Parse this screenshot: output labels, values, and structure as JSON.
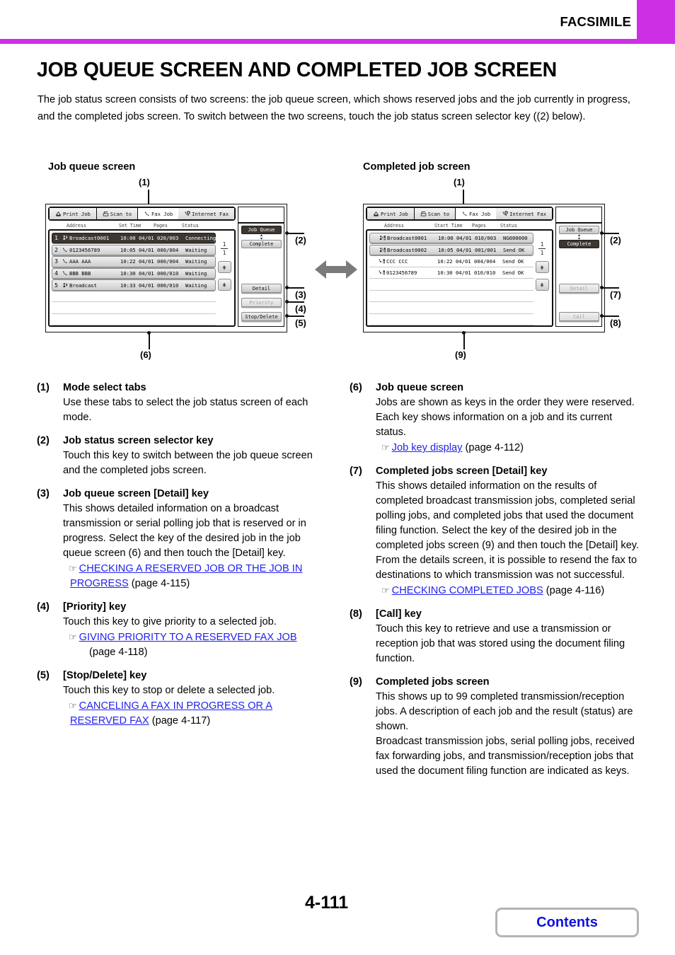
{
  "header": {
    "section_title": "FACSIMILE",
    "accent_color": "#cc2fe4"
  },
  "page": {
    "title": "JOB QUEUE SCREEN AND COMPLETED JOB SCREEN",
    "intro": "The job status screen consists of two screens: the job queue screen, which shows reserved jobs and the job currently in progress, and the completed jobs screen. To switch between the two screens, touch the job status screen selector key ((2) below).",
    "page_number": "4-111",
    "contents_label": "Contents"
  },
  "diagram": {
    "left_caption": "Job queue screen",
    "right_caption": "Completed job screen",
    "center_arrow": "double-arrow",
    "callouts": {
      "c1": "(1)",
      "c2": "(2)",
      "c3": "(3)",
      "c4": "(4)",
      "c5": "(5)",
      "c6": "(6)",
      "c7": "(7)",
      "c8": "(8)",
      "c9": "(9)"
    },
    "tabs": [
      {
        "label": "Print Job",
        "icon": "printer-icon",
        "active": false
      },
      {
        "label": "Scan to",
        "icon": "scanner-icon",
        "active": false
      },
      {
        "label": "Fax Job",
        "icon": "fax-icon",
        "active": true
      },
      {
        "label": "Internet Fax",
        "icon": "internet-fax-icon",
        "active": false
      }
    ],
    "job_queue": {
      "columns": [
        "Address",
        "Set Time",
        "Pages",
        "Status"
      ],
      "rows": [
        {
          "num": "1",
          "icon": "broadcast-icon",
          "address": "Broadcast0001",
          "time": "10:00 04/01",
          "pages": "020/003",
          "status": "Connecting",
          "selected": true,
          "is_key": true
        },
        {
          "num": "2",
          "icon": "fax-icon",
          "address": "0123456789",
          "time": "10:05 04/01",
          "pages": "000/004",
          "status": "Waiting",
          "selected": false,
          "is_key": true
        },
        {
          "num": "3",
          "icon": "fax-icon",
          "address": "AAA AAA",
          "time": "10:22 04/01",
          "pages": "000/004",
          "status": "Waiting",
          "selected": false,
          "is_key": true
        },
        {
          "num": "4",
          "icon": "fax-icon",
          "address": "BBB BBB",
          "time": "10:30 04/01",
          "pages": "000/010",
          "status": "Waiting",
          "selected": false,
          "is_key": true
        },
        {
          "num": "5",
          "icon": "serial-poll-icon",
          "address": "Broadcast",
          "time": "10:33 04/01",
          "pages": "000/010",
          "status": "Waiting",
          "selected": false,
          "is_key": true
        }
      ],
      "page_top": "1",
      "page_bottom": "1",
      "selector": {
        "top_label": "Job Queue",
        "bottom_label": "Complete",
        "active": "top"
      },
      "buttons": [
        {
          "label": "Detail",
          "enabled": true
        },
        {
          "label": "Priority",
          "enabled": false
        },
        {
          "label": "Stop/Delete",
          "enabled": true
        }
      ]
    },
    "completed": {
      "columns": [
        "Address",
        "Start Time",
        "Pages",
        "Status"
      ],
      "rows": [
        {
          "num": "",
          "icon": "broadcast-file-icon",
          "address": "Broadcast0001",
          "time": "10:00 04/01",
          "pages": "010/003",
          "status": "NG000000",
          "selected": false,
          "is_key": true
        },
        {
          "num": "",
          "icon": "broadcast-file-icon",
          "address": "Broadcast0002",
          "time": "10:05 04/01",
          "pages": "001/001",
          "status": "Send OK",
          "selected": false,
          "is_key": true
        },
        {
          "num": "",
          "icon": "fax-file-icon",
          "address": "CCC CCC",
          "time": "10:22 04/01",
          "pages": "004/004",
          "status": "Send OK",
          "selected": false,
          "is_key": false
        },
        {
          "num": "",
          "icon": "fax-file-icon",
          "address": "0123456789",
          "time": "10:30 04/01",
          "pages": "010/010",
          "status": "Send OK",
          "selected": false,
          "is_key": false
        }
      ],
      "page_top": "1",
      "page_bottom": "1",
      "selector": {
        "top_label": "Job Queue",
        "bottom_label": "Complete",
        "active": "bottom"
      },
      "buttons": [
        {
          "label": "Detail",
          "enabled": false
        },
        {
          "label": "Call",
          "enabled": false
        }
      ]
    }
  },
  "legend": {
    "left": [
      {
        "num": "(1)",
        "title": "Mode select tabs",
        "body": "Use these tabs to select the job status screen of each mode.",
        "refs": []
      },
      {
        "num": "(2)",
        "title": "Job status screen selector key",
        "body": "Touch this key to switch between the job queue screen and the completed jobs screen.",
        "refs": []
      },
      {
        "num": "(3)",
        "title": "Job queue screen [Detail] key",
        "body": "This shows detailed information on a broadcast transmission or serial polling job that is reserved or in progress. Select the key of the desired job in the job queue screen (6) and then touch the [Detail] key.",
        "refs": [
          {
            "link": "CHECKING A RESERVED JOB OR THE JOB IN PROGRESS",
            "page": "(page 4-115)"
          }
        ]
      },
      {
        "num": "(4)",
        "title": "[Priority] key",
        "body": "Touch this key to give priority to a selected job.",
        "refs": [
          {
            "link": "GIVING PRIORITY TO A RESERVED FAX JOB",
            "page": "(page 4-118)"
          }
        ]
      },
      {
        "num": "(5)",
        "title": "[Stop/Delete] key",
        "body": "Touch this key to stop or delete a selected job.",
        "refs": [
          {
            "link": "CANCELING A FAX IN PROGRESS OR A RESERVED FAX",
            "page": "(page 4-117)"
          }
        ]
      }
    ],
    "right": [
      {
        "num": "(6)",
        "title": "Job queue screen",
        "body": "Jobs are shown as keys in the order they were reserved. Each key shows information on a job and its current status.",
        "refs": [
          {
            "link": "Job key display",
            "page": "(page 4-112)"
          }
        ]
      },
      {
        "num": "(7)",
        "title": "Completed jobs screen [Detail] key",
        "body": "This shows detailed information on the results of completed broadcast transmission jobs, completed serial polling jobs, and completed jobs that used the document filing function. Select the key of the desired job in the completed jobs screen (9) and then touch the [Detail] key.",
        "body2": "From the details screen, it is possible to resend the fax to destinations to which transmission was not successful.",
        "refs": [
          {
            "link": "CHECKING COMPLETED JOBS",
            "page": "(page 4-116)"
          }
        ]
      },
      {
        "num": "(8)",
        "title": "[Call] key",
        "body": "Touch this key to retrieve and use a transmission or reception job that was stored using the document filing function.",
        "refs": []
      },
      {
        "num": "(9)",
        "title": "Completed jobs screen",
        "body": "This shows up to 99 completed transmission/reception jobs. A description of each job and the result (status) are shown.",
        "body2": "Broadcast transmission jobs, serial polling jobs, received fax forwarding jobs, and transmission/reception jobs that used the document filing function are indicated as keys.",
        "refs": []
      }
    ]
  }
}
